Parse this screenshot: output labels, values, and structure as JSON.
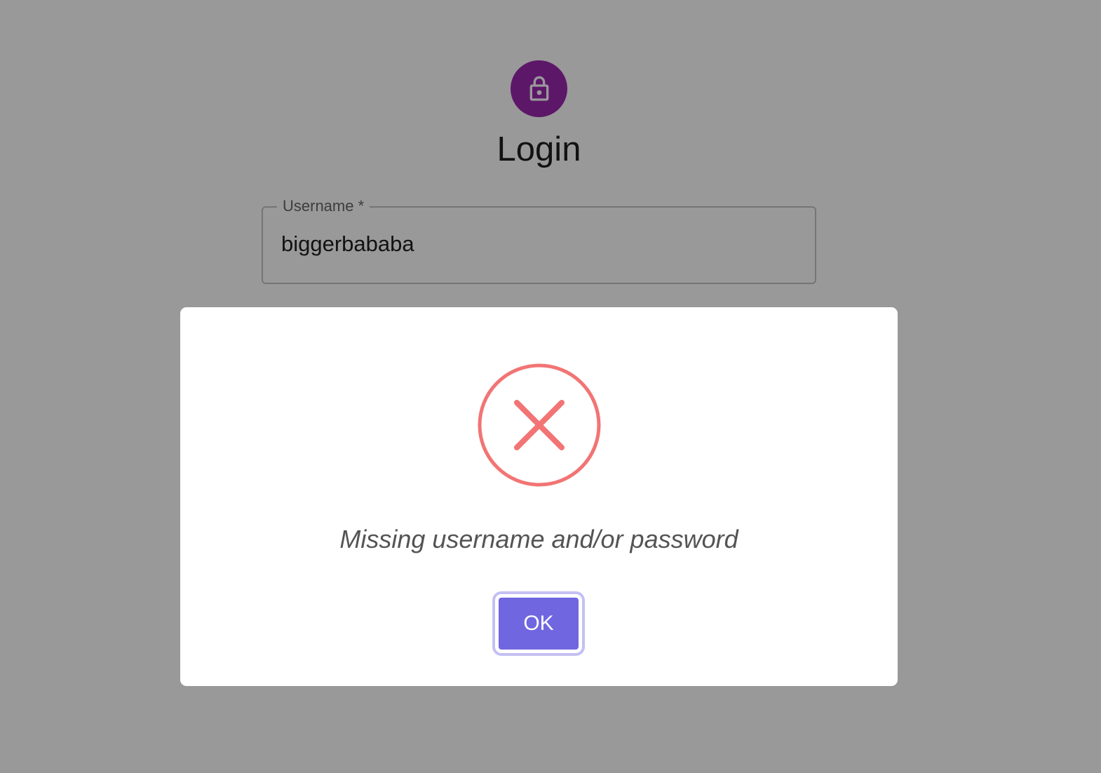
{
  "login": {
    "title": "Login",
    "username_label": "Username *",
    "username_value": "biggerbababa",
    "avatar_icon": "lock-icon",
    "avatar_color": "#9c27b0"
  },
  "modal": {
    "icon": "error-x-icon",
    "icon_color": "#f27474",
    "message": "Missing username and/or password",
    "ok_label": "OK",
    "ok_color": "#7066e0"
  }
}
